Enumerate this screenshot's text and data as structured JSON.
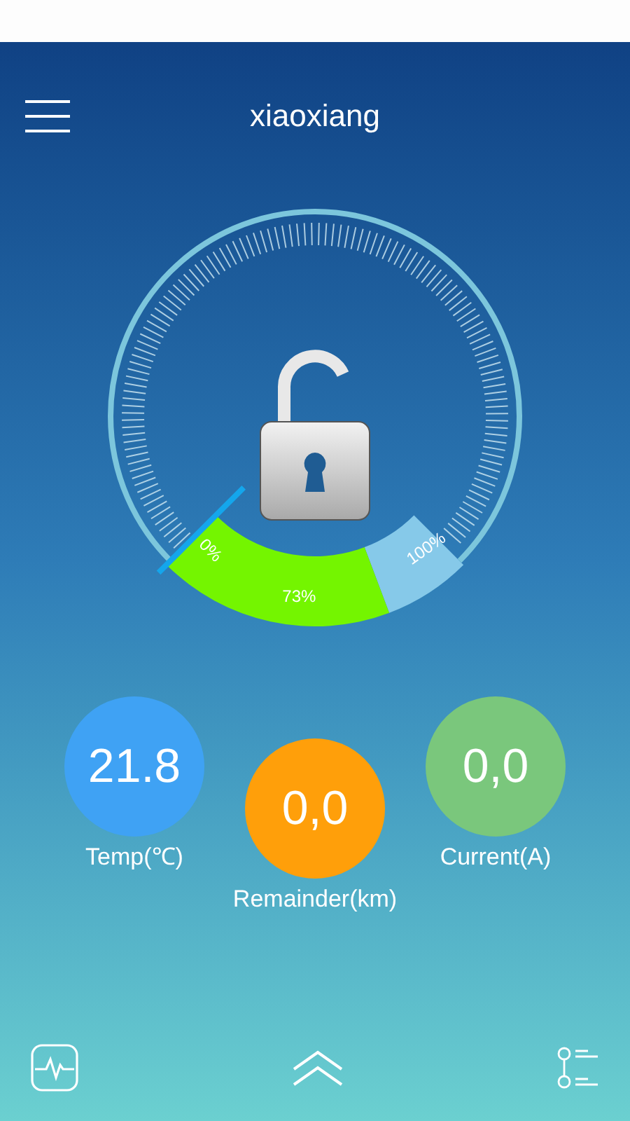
{
  "header": {
    "title": "xiaoxiang"
  },
  "gauge": {
    "locked": false,
    "start_label": "0%",
    "level_label": "73%",
    "end_label": "100%"
  },
  "readings": [
    {
      "value": "21.8",
      "label": "Temp(℃)",
      "color": "#3fa2f4"
    },
    {
      "value": "0,0",
      "label": "Remainder(km)",
      "color": "#ff9f0a"
    },
    {
      "value": "0,0",
      "label": "Current(A)",
      "color": "#7ac77c"
    }
  ]
}
